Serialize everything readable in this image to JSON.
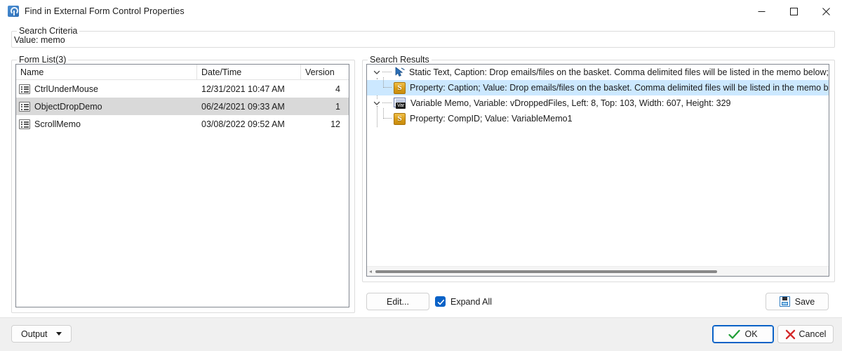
{
  "window": {
    "title": "Find in External Form Control Properties",
    "icon": "app-icon",
    "controls": {
      "minimize": "minimize-icon",
      "maximize": "maximize-icon",
      "close": "close-icon"
    }
  },
  "search_criteria": {
    "group_label": "Search Criteria",
    "value_line": "Value: memo"
  },
  "form_list": {
    "group_label": "Form List(3)",
    "columns": [
      "Name",
      "Date/Time",
      "Version"
    ],
    "rows": [
      {
        "name": "CtrlUnderMouse",
        "date": "12/31/2021 10:47 AM",
        "version": "4",
        "selected": false
      },
      {
        "name": "ObjectDropDemo",
        "date": "06/24/2021 09:33 AM",
        "version": "1",
        "selected": true
      },
      {
        "name": "ScrollMemo",
        "date": "03/08/2022 09:52 AM",
        "version": "12",
        "selected": false
      }
    ]
  },
  "search_results": {
    "group_label": "Search Results",
    "nodes": [
      {
        "id": "static-text-node",
        "level": 0,
        "expanded": true,
        "icon": "cursor-arrow-icon",
        "label": "Static Text, Caption: Drop emails/files on the basket. Comma delimited files will be listed in the memo below;, Left",
        "selected": false
      },
      {
        "id": "caption-property-node",
        "level": 1,
        "expanded": false,
        "icon": "property-s-icon",
        "label": "Property: Caption; Value: Drop emails/files on the basket. Comma delimited files will be listed in the memo b",
        "selected": true
      },
      {
        "id": "variable-memo-node",
        "level": 0,
        "expanded": true,
        "icon": "variable-memo-icon",
        "icon_tag": "Var",
        "label": "Variable Memo, Variable: vDroppedFiles, Left: 8, Top: 103, Width: 607, Height: 329",
        "selected": false
      },
      {
        "id": "compid-property-node",
        "level": 1,
        "expanded": false,
        "icon": "property-s-icon",
        "label": "Property: CompID; Value: VariableMemo1",
        "selected": false
      }
    ],
    "scrollbar": {
      "orientation": "horizontal",
      "thumb_fraction": 0.74
    }
  },
  "actions": {
    "edit_label": "Edit...",
    "expand_all_label": "Expand All",
    "expand_all_checked": true,
    "save_label": "Save",
    "save_icon": "floppy-disk-icon"
  },
  "bottom_bar": {
    "output_label": "Output",
    "output_caret": "chevron-down-icon",
    "ok_label": "OK",
    "ok_icon": "checkmark-icon",
    "cancel_label": "Cancel",
    "cancel_icon": "x-mark-icon"
  },
  "colors": {
    "accent": "#0a62c7",
    "selection_list": "#d9d9d9",
    "selection_tree": "#cce8ff",
    "ok_check": "#1f9d34",
    "cancel_x": "#d4292a",
    "property_icon": "#d79a14",
    "window_bg": "#ffffff",
    "bottom_bar_bg": "#f0f0f0"
  }
}
